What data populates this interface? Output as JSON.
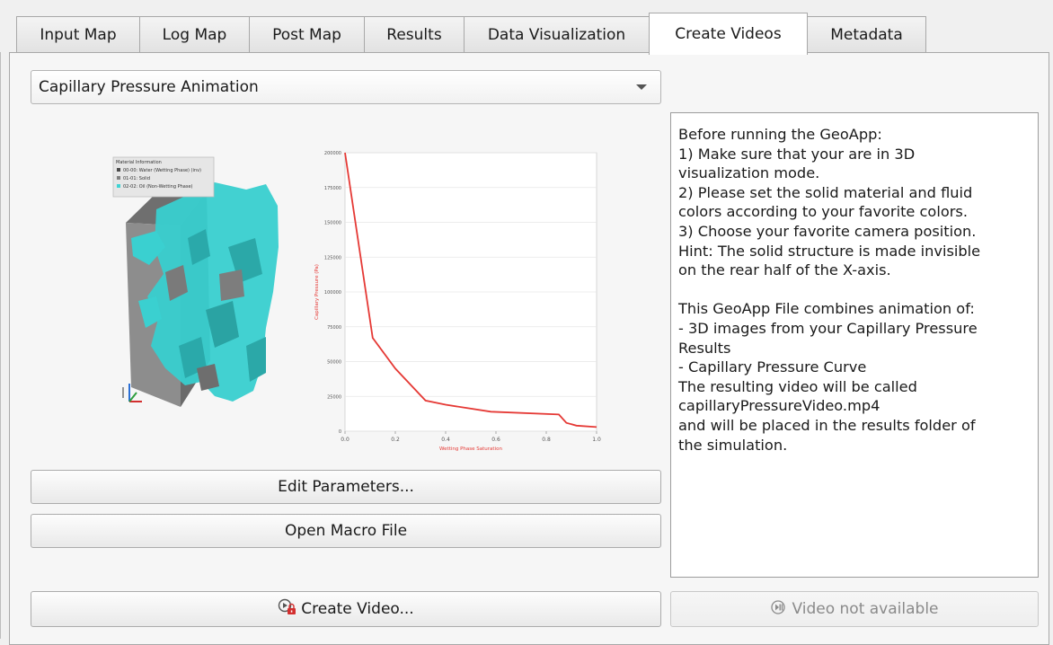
{
  "tabs": [
    {
      "label": "Input Map"
    },
    {
      "label": "Log Map"
    },
    {
      "label": "Post Map"
    },
    {
      "label": "Results"
    },
    {
      "label": "Data Visualization"
    },
    {
      "label": "Create Videos",
      "active": true
    },
    {
      "label": "Metadata"
    }
  ],
  "animation_select": {
    "value": "Capillary Pressure Animation"
  },
  "preview": {
    "legend": {
      "title": "Material Information",
      "items": [
        {
          "label": "00-00: Water (Wetting Phase) (inv)",
          "color": "#4a4a4a"
        },
        {
          "label": "01-01: Solid",
          "color": "#808080"
        },
        {
          "label": "02-02: Oil (Non-Wetting Phase)",
          "color": "#3fd3d3"
        }
      ]
    }
  },
  "chart_data": {
    "type": "line",
    "xlabel": "Wetting Phase Saturation",
    "ylabel": "Capillary Pressure (Pa)",
    "xlim": [
      0.0,
      1.0
    ],
    "ylim": [
      0,
      200000
    ],
    "x_ticks": [
      "0.0",
      "0.2",
      "0.4",
      "0.6",
      "0.8",
      "1.0"
    ],
    "y_ticks": [
      "0",
      "25000",
      "50000",
      "75000",
      "100000",
      "125000",
      "150000",
      "175000",
      "200000"
    ],
    "grid": true,
    "line_color": "#e53935",
    "series": [
      {
        "x": [
          0.0,
          0.11,
          0.2,
          0.32,
          0.4,
          0.58,
          0.85,
          0.88,
          0.92,
          1.0
        ],
        "y": [
          200000,
          67000,
          45000,
          22000,
          19000,
          14000,
          12000,
          6000,
          4000,
          3000
        ]
      }
    ]
  },
  "info_text": [
    "Before running the GeoApp:",
    "1) Make sure that your are in 3D",
    "visualization mode.",
    "2) Please set the solid material and fluid",
    "colors according to your favorite colors.",
    "3) Choose your favorite camera position.",
    "Hint: The solid structure is made invisible",
    "on the rear half of the X-axis.",
    "",
    "This GeoApp File combines animation of:",
    "- 3D images from your Capillary Pressure",
    "Results",
    "- Capillary Pressure Curve",
    "The resulting video will be called",
    "capillaryPressureVideo.mp4",
    "and will be placed in the results folder of",
    "the simulation."
  ],
  "buttons": {
    "edit_parameters": "Edit Parameters...",
    "open_macro": "Open Macro File",
    "create_video": "Create Video...",
    "video_status": "Video not available"
  },
  "icons": {
    "create_video": "video-lock-icon",
    "video_status": "play-pause-icon"
  }
}
